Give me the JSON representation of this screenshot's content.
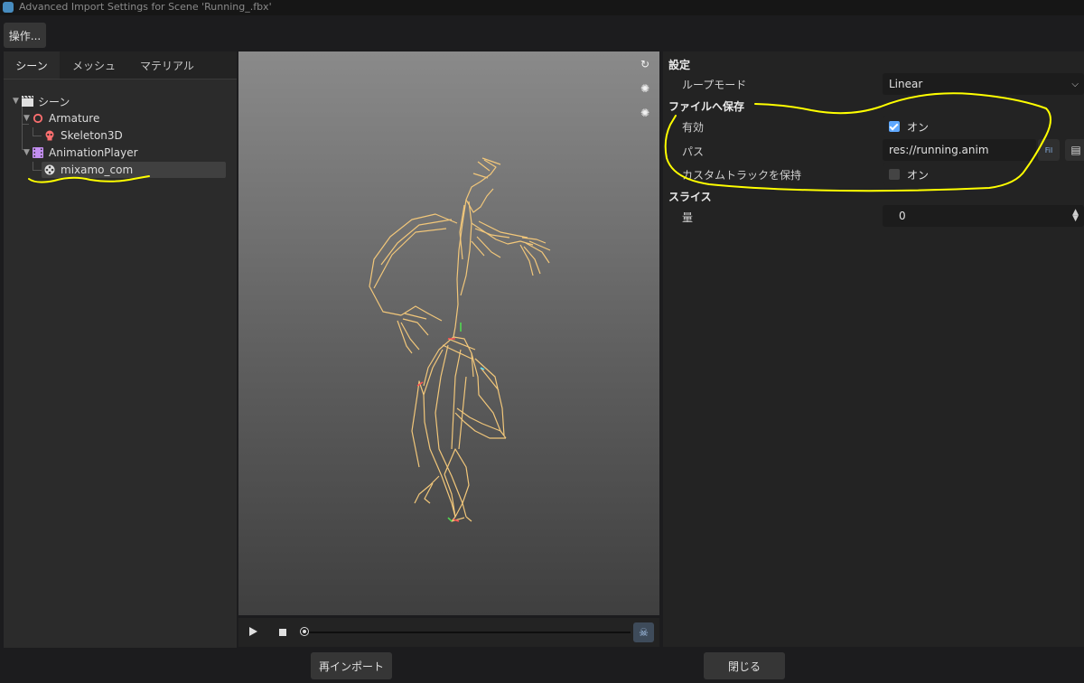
{
  "window": {
    "title": "Advanced Import Settings for Scene 'Running_.fbx'"
  },
  "toolbar": {
    "operations_label": "操作..."
  },
  "tabs": [
    {
      "label": "シーン",
      "active": true
    },
    {
      "label": "メッシュ",
      "active": false
    },
    {
      "label": "マテリアル",
      "active": false
    }
  ],
  "tree": {
    "root": "シーン",
    "armature": "Armature",
    "skeleton": "Skeleton3D",
    "animation_player": "AnimationPlayer",
    "animation": "mixamo_com"
  },
  "inspector": {
    "settings_section": "設定",
    "loop_mode_label": "ループモード",
    "loop_mode_value": "Linear",
    "save_section": "ファイルへ保存",
    "enabled_label": "有効",
    "enabled_value": "オン",
    "enabled_checked": true,
    "path_label": "パス",
    "path_value": "res://running.anim",
    "keep_tracks_label": "カスタムトラックを保持",
    "keep_tracks_value": "オン",
    "keep_tracks_checked": false,
    "slice_section": "スライス",
    "amount_label": "量",
    "amount_value": "0"
  },
  "buttons": {
    "reimport": "再インポート",
    "close": "閉じる"
  },
  "colors": {
    "accent": "#5fa8ff",
    "annotation": "#ffff00",
    "skeleton": "#f2c77a"
  }
}
